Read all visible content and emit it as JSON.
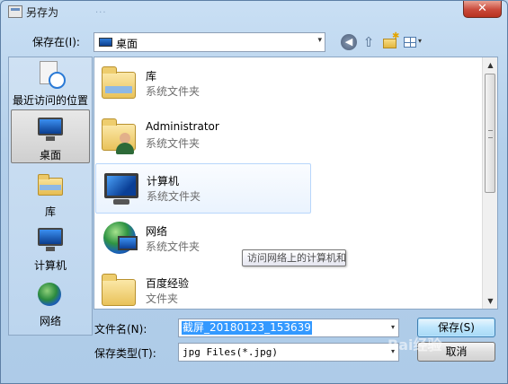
{
  "window": {
    "title": "另存为",
    "ghost_tabs": "...",
    "close_glyph": "✕"
  },
  "toolbar": {
    "save_in_label": "保存在(I):",
    "save_in_value": "桌面",
    "combo_arrow": "▾",
    "back_glyph": "◀",
    "up_glyph": "⇧",
    "new_folder_star": "✱",
    "views_arrow": "▾"
  },
  "places": [
    {
      "label": "最近访问的位置",
      "icon": "recent-places-icon",
      "selected": false
    },
    {
      "label": "桌面",
      "icon": "desktop-icon",
      "selected": true
    },
    {
      "label": "库",
      "icon": "libraries-icon",
      "selected": false
    },
    {
      "label": "计算机",
      "icon": "computer-icon",
      "selected": false
    },
    {
      "label": "网络",
      "icon": "network-icon",
      "selected": false
    }
  ],
  "files": [
    {
      "name": "库",
      "type": "系统文件夹",
      "icon": "library-folder-icon"
    },
    {
      "name": "Administrator",
      "type": "系统文件夹",
      "icon": "user-folder-icon"
    },
    {
      "name": "计算机",
      "type": "系统文件夹",
      "icon": "computer-icon"
    },
    {
      "name": "网络",
      "type": "系统文件夹",
      "icon": "network-icon"
    },
    {
      "name": "百度经验",
      "type": "文件夹",
      "icon": "folder-icon"
    }
  ],
  "tooltip": "访问网络上的计算机和设备。",
  "scrollbar": {
    "up": "▲",
    "down": "▼"
  },
  "form": {
    "filename_label": "文件名(N):",
    "filename_value": "截屏_20180123_153639",
    "filetype_label": "保存类型(T):",
    "filetype_value": "jpg Files(*.jpg)",
    "arrow": "▾"
  },
  "buttons": {
    "save": "保存(S)",
    "cancel": "取消"
  },
  "watermark": "Bai经验"
}
